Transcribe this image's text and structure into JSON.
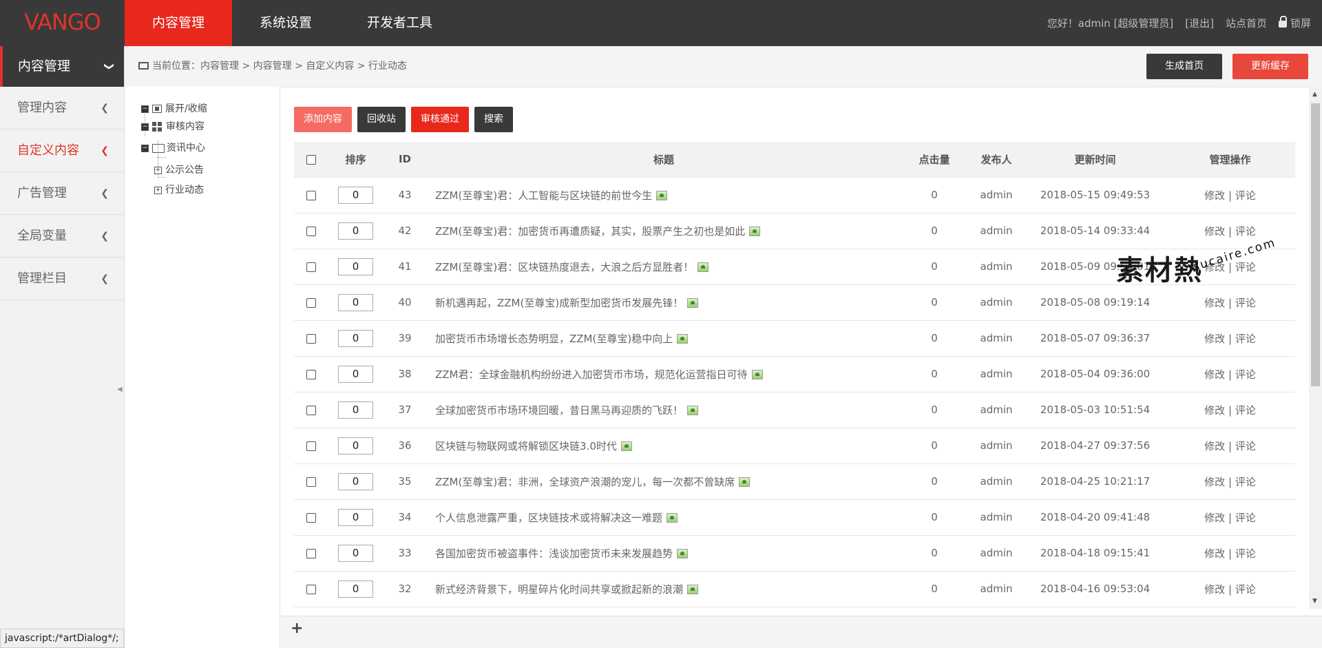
{
  "logo": "VANGO",
  "topnav": [
    "内容管理",
    "系统设置",
    "开发者工具"
  ],
  "topright": {
    "greeting": "您好！admin [超级管理员]",
    "logout": "[退出]",
    "home": "站点首页",
    "lock": "锁屏"
  },
  "sidebar": {
    "head": "内容管理",
    "items": [
      {
        "label": "管理内容"
      },
      {
        "label": "自定义内容"
      },
      {
        "label": "广告管理"
      },
      {
        "label": "全局变量"
      },
      {
        "label": "管理栏目"
      }
    ]
  },
  "breadcrumb": "当前位置：内容管理 > 内容管理 > 自定义内容 > 行业动态",
  "header_buttons": {
    "generate": "生成首页",
    "cache": "更新缓存"
  },
  "tree": {
    "toggle": "展开/收缩",
    "audit": "审核内容",
    "news": "资讯中心",
    "notice": "公示公告",
    "industry": "行业动态"
  },
  "actions": {
    "add": "添加内容",
    "recycle": "回收站",
    "approve": "审核通过",
    "search": "搜索"
  },
  "table": {
    "headers": {
      "sort": "排序",
      "id": "ID",
      "title": "标题",
      "clicks": "点击量",
      "author": "发布人",
      "time": "更新时间",
      "ops": "管理操作"
    },
    "ops": {
      "edit": "修改",
      "sep": "|",
      "comment": "评论"
    },
    "rows": [
      {
        "sort": "0",
        "id": "43",
        "title": "ZZM(至尊宝)君：人工智能与区块链的前世今生",
        "clicks": "0",
        "author": "admin",
        "time": "2018-05-15 09:49:53"
      },
      {
        "sort": "0",
        "id": "42",
        "title": "ZZM(至尊宝)君：加密货币再遭质疑，其实，股票产生之初也是如此",
        "clicks": "0",
        "author": "admin",
        "time": "2018-05-14 09:33:44"
      },
      {
        "sort": "0",
        "id": "41",
        "title": "ZZM(至尊宝)君：区块链热度退去，大浪之后方显胜者！",
        "clicks": "0",
        "author": "admin",
        "time": "2018-05-09 09:54:01"
      },
      {
        "sort": "0",
        "id": "40",
        "title": "新机遇再起，ZZM(至尊宝)成新型加密货币发展先锋！",
        "clicks": "0",
        "author": "admin",
        "time": "2018-05-08 09:19:14"
      },
      {
        "sort": "0",
        "id": "39",
        "title": "加密货币市场增长态势明显，ZZM(至尊宝)稳中向上",
        "clicks": "0",
        "author": "admin",
        "time": "2018-05-07 09:36:37"
      },
      {
        "sort": "0",
        "id": "38",
        "title": "ZZM君：全球金融机构纷纷进入加密货币市场，规范化运营指日可待",
        "clicks": "0",
        "author": "admin",
        "time": "2018-05-04 09:36:00"
      },
      {
        "sort": "0",
        "id": "37",
        "title": "全球加密货币市场环境回暖，昔日黑马再迎质的飞跃！",
        "clicks": "0",
        "author": "admin",
        "time": "2018-05-03 10:51:54"
      },
      {
        "sort": "0",
        "id": "36",
        "title": "区块链与物联网或将解锁区块链3.0时代",
        "clicks": "0",
        "author": "admin",
        "time": "2018-04-27 09:37:56"
      },
      {
        "sort": "0",
        "id": "35",
        "title": "ZZM(至尊宝)君：非洲，全球资产浪潮的宠儿，每一次都不曾缺席",
        "clicks": "0",
        "author": "admin",
        "time": "2018-04-25 10:21:17"
      },
      {
        "sort": "0",
        "id": "34",
        "title": "个人信息泄露严重，区块链技术或将解决这一难题",
        "clicks": "0",
        "author": "admin",
        "time": "2018-04-20 09:41:48"
      },
      {
        "sort": "0",
        "id": "33",
        "title": "各国加密货币被盗事件：浅谈加密货币未来发展趋势",
        "clicks": "0",
        "author": "admin",
        "time": "2018-04-18 09:15:41"
      },
      {
        "sort": "0",
        "id": "32",
        "title": "新式经济背景下，明星碎片化时间共享或掀起新的浪潮",
        "clicks": "0",
        "author": "admin",
        "time": "2018-04-16 09:53:04"
      }
    ]
  },
  "footer": {
    "plus": "+"
  },
  "statusbar": "javascript:/*artDialog*/;",
  "watermark": {
    "brand": "素材熱",
    "site": "sucaire.com"
  }
}
